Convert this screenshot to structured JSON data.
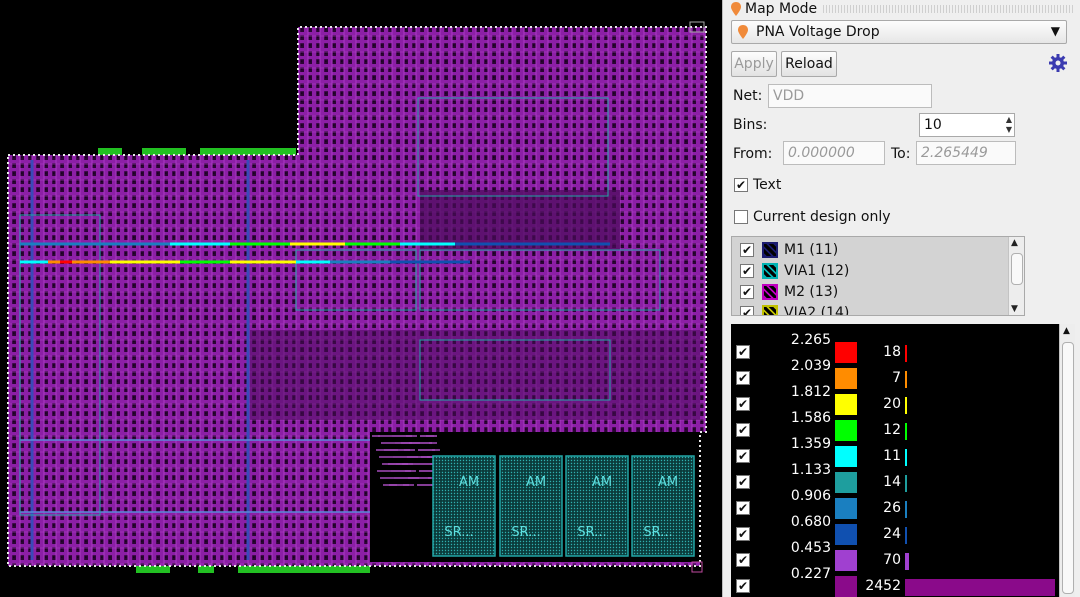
{
  "panel": {
    "title": "Map Mode",
    "combo_value": "PNA Voltage Drop",
    "apply_label": "Apply",
    "reload_label": "Reload",
    "net_label": "Net:",
    "net_placeholder": "VDD",
    "bins_label": "Bins:",
    "bins_value": "10",
    "from_label": "From:",
    "from_value": "0.000000",
    "to_label": "To:",
    "to_value": "2.265449",
    "text_label": "Text",
    "text_checked": true,
    "current_design_label": "Current design only",
    "current_design_checked": false,
    "layers": [
      {
        "label": "M1 (11)",
        "checked": true,
        "color": "#1a1a6e"
      },
      {
        "label": "VIA1 (12)",
        "checked": true,
        "color": "#00b3b3"
      },
      {
        "label": "M2 (13)",
        "checked": true,
        "color": "#c000c0"
      },
      {
        "label": "VIA2 (14)",
        "checked": true,
        "color": "#c0c000"
      }
    ]
  },
  "legend": {
    "rows": [
      {
        "value": "2.265",
        "count": "18",
        "color": "#ff0000",
        "checked": true,
        "fraction": 0.007
      },
      {
        "value": "2.039",
        "count": "7",
        "color": "#ff8c00",
        "checked": true,
        "fraction": 0.003
      },
      {
        "value": "1.812",
        "count": "20",
        "color": "#ffff00",
        "checked": true,
        "fraction": 0.008
      },
      {
        "value": "1.586",
        "count": "12",
        "color": "#00ff00",
        "checked": true,
        "fraction": 0.005
      },
      {
        "value": "1.359",
        "count": "11",
        "color": "#00ffff",
        "checked": true,
        "fraction": 0.004
      },
      {
        "value": "1.133",
        "count": "14",
        "color": "#1e9e9e",
        "checked": true,
        "fraction": 0.006
      },
      {
        "value": "0.906",
        "count": "26",
        "color": "#1a7fc0",
        "checked": true,
        "fraction": 0.011
      },
      {
        "value": "0.680",
        "count": "24",
        "color": "#1050b0",
        "checked": true,
        "fraction": 0.01
      },
      {
        "value": "0.453",
        "count": "70",
        "color": "#a040d0",
        "checked": true,
        "fraction": 0.028
      },
      {
        "value": "0.227",
        "count": "2452",
        "color": "#8a0a8a",
        "checked": true,
        "fraction": 1.0
      }
    ]
  },
  "layout": {
    "macro_labels": [
      {
        "top": "AM",
        "bottom": "SR..."
      },
      {
        "top": "AM",
        "bottom": "SR..."
      },
      {
        "top": "AM",
        "bottom": "SR..."
      },
      {
        "top": "AM",
        "bottom": "SR..."
      }
    ],
    "colors": {
      "metal": "#8c1fa6",
      "dense": "#4a0c5a",
      "via": "#22a6a6",
      "pin": "#22c022",
      "boundary": "#e8e8e8"
    }
  }
}
